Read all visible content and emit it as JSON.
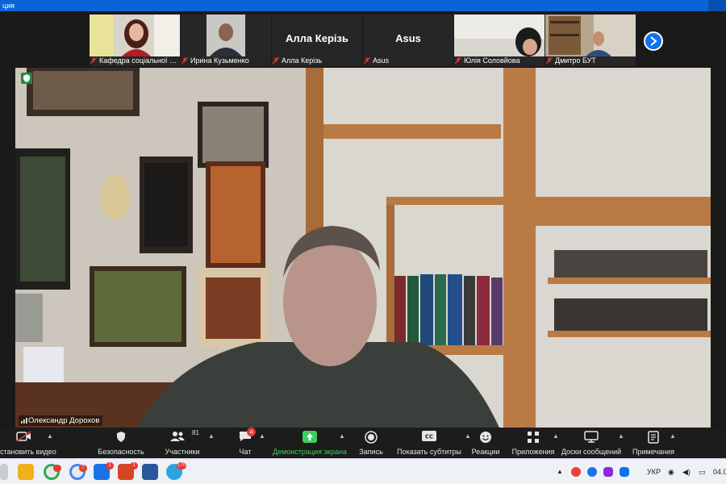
{
  "window": {
    "title": "ция"
  },
  "thumbnails": [
    {
      "label": "Кафедра соціальної п...",
      "mode": "video",
      "muted": true
    },
    {
      "label": "Ирина Кузьменко",
      "mode": "video",
      "muted": true
    },
    {
      "label": "Алла Керізь",
      "display_name": "Алла Керізь",
      "mode": "name",
      "muted": true
    },
    {
      "label": "Asus",
      "display_name": "Asus",
      "mode": "name",
      "muted": true
    },
    {
      "label": "Юлія Соловйова",
      "mode": "video",
      "muted": true
    },
    {
      "label": "Дмитро БУТ",
      "mode": "video",
      "muted": true
    }
  ],
  "main_speaker": {
    "name": "Олександр Дорохов"
  },
  "toolbar": {
    "video_label": "становить видео",
    "security_label": "Безопасность",
    "participants_label": "Участники",
    "participants_count": "81",
    "chat_label": "Чат",
    "chat_badge": "4",
    "share_label": "Демонстрация экрана",
    "record_label": "Запись",
    "subtitles_label": "Показать субтитры",
    "reactions_label": "Реакции",
    "apps_label": "Приложения",
    "whiteboards_label": "Доски сообщений",
    "notes_label": "Примечания"
  },
  "taskbar": {
    "badges": {
      "chrome2": "7",
      "app": "1",
      "ppt": "1",
      "telegram": "170"
    },
    "language": "УКР",
    "time": "04.0"
  },
  "colors": {
    "zoom_blue": "#0e72ed",
    "share_green": "#3ad15a",
    "badge_red": "#e53935"
  }
}
